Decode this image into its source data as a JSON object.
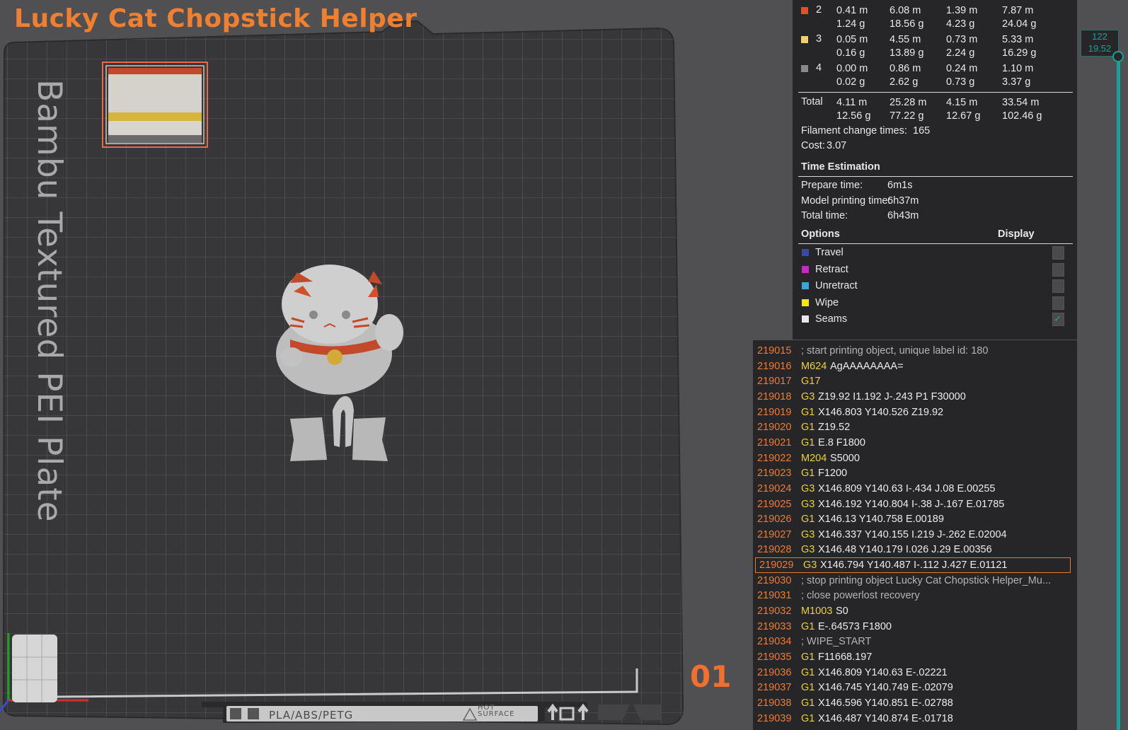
{
  "plate": {
    "title": "Lucky Cat Chopstick Helper",
    "bed_label": "Bambu Textured PEI Plate",
    "number": "01",
    "strip_text": "PLA/ABS/PETG",
    "hot_text_line1": "HOT",
    "hot_text_line2": "SURFACE"
  },
  "filaments": [
    {
      "id": "2",
      "color": "#e0502a",
      "c1a": "0.41 m",
      "c1b": "1.24 g",
      "c2a": "6.08 m",
      "c2b": "18.56 g",
      "c3a": "1.39 m",
      "c3b": "4.23 g",
      "c4a": "7.87 m",
      "c4b": "24.04 g"
    },
    {
      "id": "3",
      "color": "#f0d068",
      "c1a": "0.05 m",
      "c1b": "0.16 g",
      "c2a": "4.55 m",
      "c2b": "13.89 g",
      "c3a": "0.73 m",
      "c3b": "2.24 g",
      "c4a": "5.33 m",
      "c4b": "16.29 g"
    },
    {
      "id": "4",
      "color": "#888888",
      "c1a": "0.00 m",
      "c1b": "0.02 g",
      "c2a": "0.86 m",
      "c2b": "2.62 g",
      "c3a": "0.24 m",
      "c3b": "0.73 g",
      "c4a": "1.10 m",
      "c4b": "3.37 g"
    }
  ],
  "total": {
    "label": "Total",
    "c1a": "4.11 m",
    "c1b": "12.56 g",
    "c2a": "25.28 m",
    "c2b": "77.22 g",
    "c3a": "4.15 m",
    "c3b": "12.67 g",
    "c4a": "33.54 m",
    "c4b": "102.46 g"
  },
  "summary": {
    "filament_change_label": "Filament change times:",
    "filament_change_value": "165",
    "cost_label": "Cost:",
    "cost_value": "3.07"
  },
  "time_estimation": {
    "heading": "Time Estimation",
    "rows": [
      {
        "label": "Prepare time:",
        "value": "6m1s"
      },
      {
        "label": "Model printing time:",
        "value": "6h37m"
      },
      {
        "label": "Total time:",
        "value": "6h43m"
      }
    ]
  },
  "options": {
    "heading": "Options",
    "display_heading": "Display",
    "items": [
      {
        "label": "Travel",
        "color": "#3848a8",
        "checked": false
      },
      {
        "label": "Retract",
        "color": "#c628c6",
        "checked": false
      },
      {
        "label": "Unretract",
        "color": "#38a8d8",
        "checked": false
      },
      {
        "label": "Wipe",
        "color": "#f0e810",
        "checked": false
      },
      {
        "label": "Seams",
        "color": "#e8e8e8",
        "checked": true
      }
    ]
  },
  "layer_slider": {
    "top_layer": "122",
    "top_height": "19.52"
  },
  "gcode": {
    "current_line": "219029",
    "lines": [
      {
        "num": "219015",
        "cmd": "",
        "args": "",
        "comment": "; start printing object, unique label id: 180"
      },
      {
        "num": "219016",
        "cmd": "M624",
        "args": "AgAAAAAAAA=",
        "comment": ""
      },
      {
        "num": "219017",
        "cmd": "G17",
        "args": "",
        "comment": ""
      },
      {
        "num": "219018",
        "cmd": "G3",
        "args": "Z19.92 I1.192 J-.243 P1 F30000",
        "comment": ""
      },
      {
        "num": "219019",
        "cmd": "G1",
        "args": "X146.803 Y140.526 Z19.92",
        "comment": ""
      },
      {
        "num": "219020",
        "cmd": "G1",
        "args": "Z19.52",
        "comment": ""
      },
      {
        "num": "219021",
        "cmd": "G1",
        "args": "E.8 F1800",
        "comment": ""
      },
      {
        "num": "219022",
        "cmd": "M204",
        "args": "S5000",
        "comment": ""
      },
      {
        "num": "219023",
        "cmd": "G1",
        "args": "F1200",
        "comment": ""
      },
      {
        "num": "219024",
        "cmd": "G3",
        "args": "X146.809 Y140.63 I-.434 J.08 E.00255",
        "comment": ""
      },
      {
        "num": "219025",
        "cmd": "G3",
        "args": "X146.192 Y140.804 I-.38 J-.167 E.01785",
        "comment": ""
      },
      {
        "num": "219026",
        "cmd": "G1",
        "args": "X146.13 Y140.758 E.00189",
        "comment": ""
      },
      {
        "num": "219027",
        "cmd": "G3",
        "args": "X146.337 Y140.155 I.219 J-.262 E.02004",
        "comment": ""
      },
      {
        "num": "219028",
        "cmd": "G3",
        "args": "X146.48 Y140.179 I.026 J.29 E.00356",
        "comment": ""
      },
      {
        "num": "219029",
        "cmd": "G3",
        "args": "X146.794 Y140.487 I-.112 J.427 E.01121",
        "comment": ""
      },
      {
        "num": "219030",
        "cmd": "",
        "args": "",
        "comment": "; stop printing object Lucky Cat Chopstick Helper_Mu..."
      },
      {
        "num": "219031",
        "cmd": "",
        "args": "",
        "comment": "; close powerlost recovery"
      },
      {
        "num": "219032",
        "cmd": "M1003",
        "args": "S0",
        "comment": ""
      },
      {
        "num": "219033",
        "cmd": "G1",
        "args": "E-.64573 F1800",
        "comment": ""
      },
      {
        "num": "219034",
        "cmd": "",
        "args": "",
        "comment": "; WIPE_START"
      },
      {
        "num": "219035",
        "cmd": "G1",
        "args": "F11668.197",
        "comment": ""
      },
      {
        "num": "219036",
        "cmd": "G1",
        "args": "X146.809 Y140.63 E-.02221",
        "comment": ""
      },
      {
        "num": "219037",
        "cmd": "G1",
        "args": "X146.745 Y140.749 E-.02079",
        "comment": ""
      },
      {
        "num": "219038",
        "cmd": "G1",
        "args": "X146.596 Y140.851 E-.02788",
        "comment": ""
      },
      {
        "num": "219039",
        "cmd": "G1",
        "args": "X146.487 Y140.874 E-.01718",
        "comment": ""
      }
    ]
  }
}
